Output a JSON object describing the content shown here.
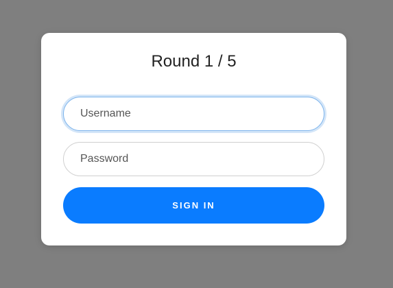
{
  "login_card": {
    "title": "Round 1 / 5",
    "username": {
      "placeholder": "Username",
      "value": ""
    },
    "password": {
      "placeholder": "Password",
      "value": ""
    },
    "sign_in_label": "SIGN IN"
  },
  "colors": {
    "background": "#7f7f7f",
    "card": "#ffffff",
    "accent": "#0a7cff",
    "focus_ring": "#7bb3ec"
  }
}
